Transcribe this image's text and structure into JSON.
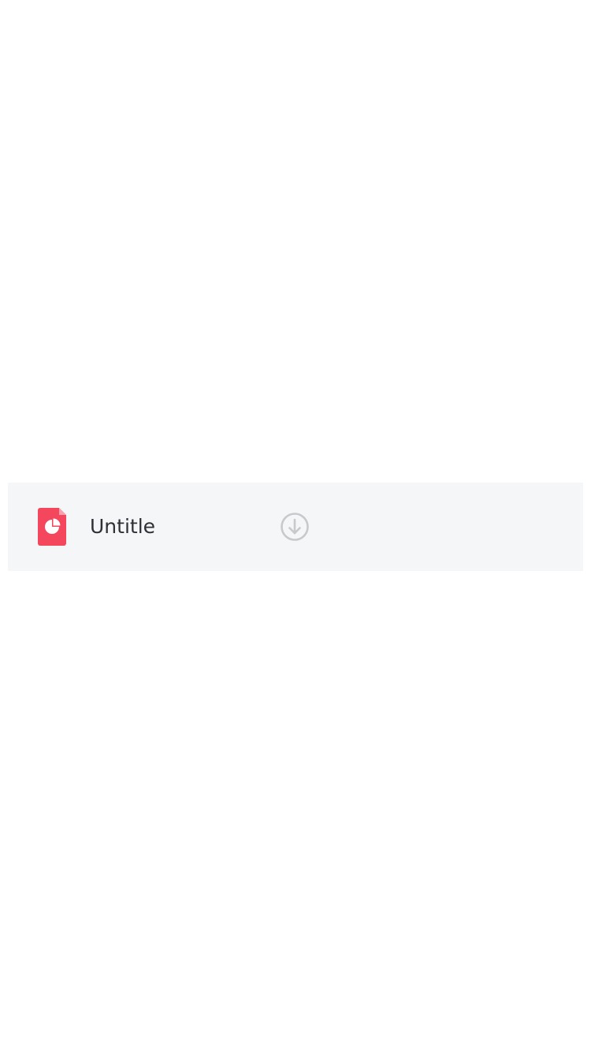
{
  "file_list": {
    "items": [
      {
        "name": "Untitle",
        "file_type_icon": "presentation-file-icon",
        "action_icon": "download-circle-icon"
      }
    ]
  },
  "colors": {
    "background": "#ffffff",
    "row_background": "#f5f6f8",
    "file_icon_red": "#f4465d",
    "file_icon_fold": "#f9a0ad",
    "text": "#2f3035",
    "download_icon": "#c8c9cc"
  }
}
